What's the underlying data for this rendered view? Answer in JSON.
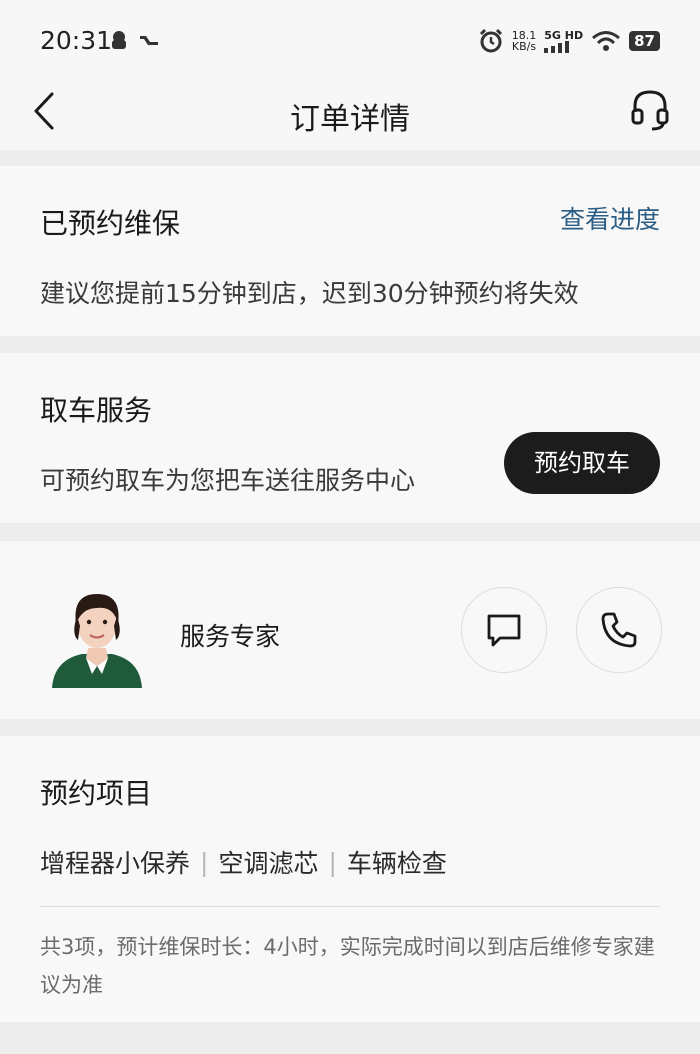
{
  "status_bar": {
    "time": "20:31",
    "speed_value": "18.1",
    "speed_unit": "KB/s",
    "network": "5G HD",
    "battery": "87"
  },
  "nav": {
    "title": "订单详情",
    "back_icon": "chevron-left-icon",
    "service_icon": "headset-icon"
  },
  "booking": {
    "title": "已预约维保",
    "link": "查看进度",
    "hint": "建议您提前15分钟到店，迟到30分钟预约将失效",
    "link_color": "#2b5d85"
  },
  "pickup": {
    "title": "取车服务",
    "desc": "可预约取车为您把车送往服务中心",
    "button": "预约取车"
  },
  "expert": {
    "label": "服务专家",
    "chat_icon": "chat-icon",
    "phone_icon": "phone-icon"
  },
  "project": {
    "title": "预约项目",
    "items": [
      "增程器小保养",
      "空调滤芯",
      "车辆检查"
    ],
    "note": "共3项，预计维保时长：4小时，实际完成时间以到店后维修专家建议为准"
  }
}
